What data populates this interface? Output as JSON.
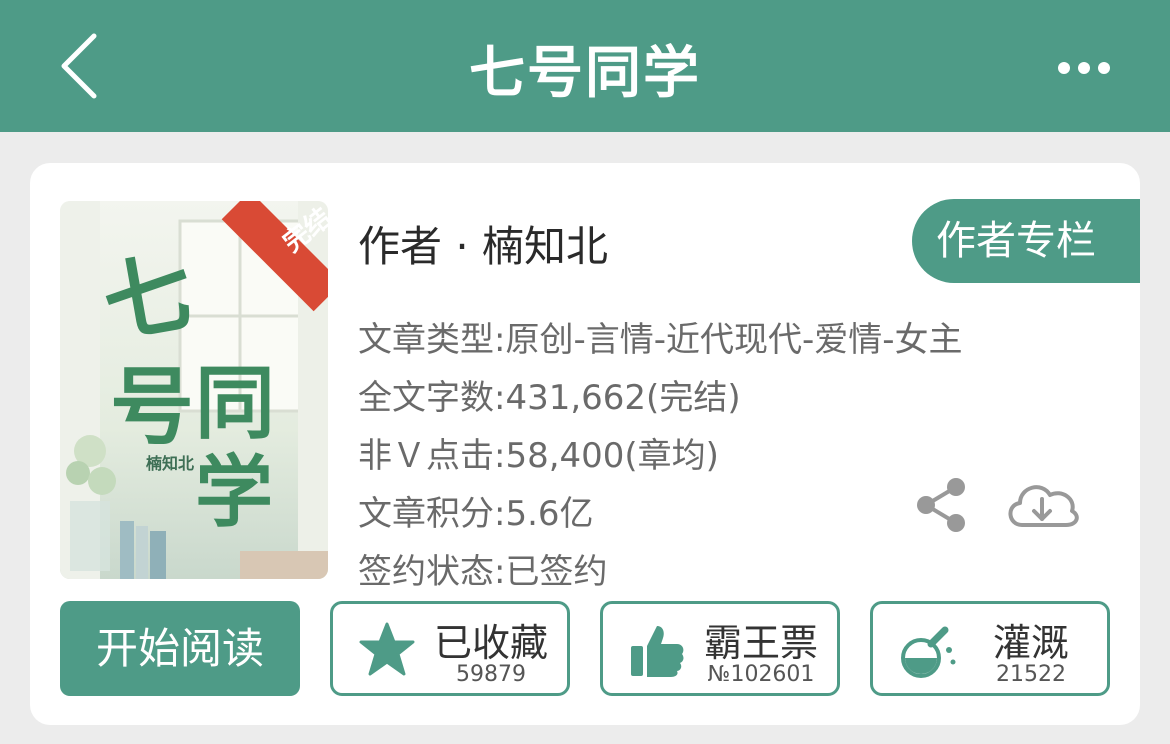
{
  "header": {
    "title": "七号同学",
    "back_icon": "chevron-left-icon",
    "more_icon": "more-dots-icon",
    "color": "#4e9b87"
  },
  "book": {
    "cover": {
      "badge": "完结",
      "title_art": "七号同学",
      "author": "楠知北"
    },
    "author_line": "作者 · 楠知北",
    "author_column_button": "作者专栏",
    "stats": [
      "文章类型:原创-言情-近代现代-爱情-女主",
      "全文字数:431,662(完结)",
      "非Ｖ点击:58,400(章均)",
      "文章积分:5.6亿",
      "签约状态:已签约"
    ],
    "share_icon": "share-icon",
    "download_icon": "cloud-download-icon"
  },
  "actions": {
    "read": "开始阅读",
    "favorite": {
      "label": "已收藏",
      "count": "59879",
      "icon": "star-icon"
    },
    "vote": {
      "label": "霸王票",
      "count": "№102601",
      "icon": "thumbs-up-icon"
    },
    "water": {
      "label": "灌溉",
      "count": "21522",
      "icon": "watering-flask-icon"
    }
  }
}
